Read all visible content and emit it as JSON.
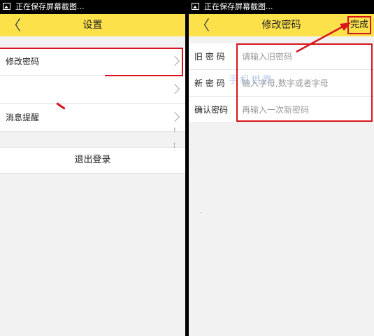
{
  "status_bar": {
    "text": "正在保存屏幕截图..."
  },
  "left": {
    "title": "设置",
    "items": [
      {
        "label": "修改密码"
      },
      {
        "label": ""
      },
      {
        "label": "消息提醒"
      }
    ],
    "logout_label": "退出登录"
  },
  "right": {
    "title": "修改密码",
    "done_label": "完成",
    "fields": [
      {
        "label": "旧 密 码",
        "placeholder": "请输入旧密码"
      },
      {
        "label": "新 密 码",
        "placeholder": "输入字母,数字或者字母"
      },
      {
        "label": "确认密码",
        "placeholder": "再输入一次新密码"
      }
    ],
    "watermark": "手机世界"
  },
  "colors": {
    "nav_yellow": "#fce14a",
    "annotation_red": "#d8151c",
    "background": "#f2f2f2"
  }
}
